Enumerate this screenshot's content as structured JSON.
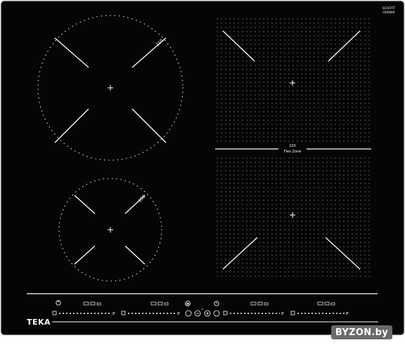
{
  "brand": {
    "logo": "TEKA",
    "glass_brand_line1": "SCHOTT",
    "glass_brand_line2": "CERAN®"
  },
  "zones": {
    "rear_left_size": "210",
    "front_left_size": "150",
    "flex_zone_size": "220",
    "flex_zone_label": "Flex Zone"
  },
  "controls": {
    "power_icon": "power-icon",
    "lock_icon": "child-lock-icon",
    "timer_icon": "timer-icon",
    "minus_icon": "minus-icon",
    "plus_icon": "plus-icon",
    "zone_function_icon": "cookware-function-icon",
    "slider_end_icon": "power-boost-icon"
  },
  "watermark": {
    "text": "BYZON.by"
  },
  "colors": {
    "glass": "#050505",
    "frame": "#1c1c1c",
    "markings": "#ffffff"
  }
}
